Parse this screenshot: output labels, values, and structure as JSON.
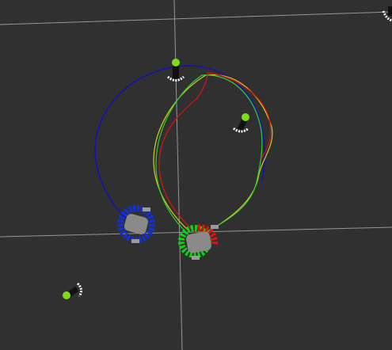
{
  "scene": {
    "background_color": "#303030",
    "grid_color": "#a0a0a0",
    "trajectory_colors": {
      "planned": "#1010c0",
      "yellow": "#d0d020",
      "green": "#30d030",
      "red": "#e01010"
    },
    "robot_colors": {
      "blue": "#1030e0",
      "green": "#10d010",
      "red": "#e01010",
      "body": "#8a8a8a"
    },
    "marker_colors": {
      "head": "#7fdc1a",
      "arc": "#ffffff",
      "post": "#111111"
    }
  }
}
